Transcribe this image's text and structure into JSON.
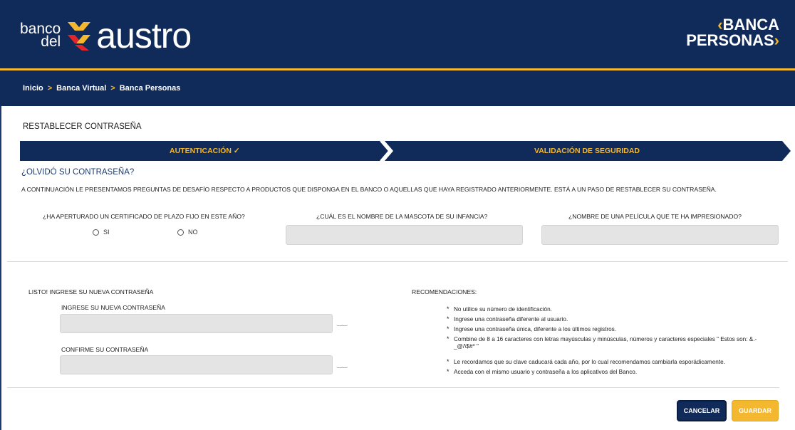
{
  "header": {
    "logo_banco": "banco",
    "logo_del": "del",
    "logo_austro": "austro",
    "brand_line1": "BANCA",
    "brand_line2": "PERSONAS",
    "colors": {
      "primary": "#102b5a",
      "accent": "#f3b82f"
    }
  },
  "breadcrumb": [
    "Inicio",
    "Banca Virtual",
    "Banca Personas"
  ],
  "page_title": "RESTABLECER CONTRASEÑA",
  "steps": {
    "step1": "AUTENTICACIÓN",
    "step1_icon": "check-icon",
    "step2": "VALIDACIÓN DE SEGURIDAD"
  },
  "forgot_title": "¿OLVIDÓ SU CONTRASEÑA?",
  "intro": "A CONTINUACIÓN LE PRESENTAMOS PREGUNTAS DE DESAFÍO RESPECTO A PRODUCTOS QUE DISPONGA EN EL BANCO O AQUELLAS QUE HAYA REGISTRADO ANTERIORMENTE. ESTÁ A UN PASO DE RESTABLECER SU CONTRASEÑA.",
  "questions": {
    "q1": "¿HA APERTURADO UN CERTIFICADO DE PLAZO FIJO EN ESTE AÑO?",
    "q1_yes": "SI",
    "q1_no": "NO",
    "q2": "¿CUÁL ES EL NOMBRE DE LA MASCOTA DE SU INFANCIA?",
    "q3": "¿NOMBRE DE UNA PELÍCULA QUE TE HA IMPRESIONADO?"
  },
  "new_password": {
    "section_title": "LISTO! INGRESE SU NUEVA CONTRASEÑA",
    "label_new": "INGRESE SU NUEVA CONTRASEÑA",
    "label_confirm": "CONFIRME SU CONTRASEÑA"
  },
  "recommendations": {
    "title": "RECOMENDACIONES:",
    "items": [
      "No utilice su número de identificación.",
      "Ingrese una contraseña diferente al usuario.",
      "Ingrese una contraseña única, diferente a los últimos registros.",
      "Combine de 8 a 16 caracteres con letras mayúsculas y minúsculas, números y caracteres especiales \" Estos son: &.-_@/\\$#* \"",
      "Le recordamos que su clave caducará cada año, por lo cual recomendamos cambiarla esporádicamente.",
      "Acceda con el mismo usuario y contraseña a los aplicativos del Banco."
    ]
  },
  "buttons": {
    "cancel": "CANCELAR",
    "save": "GUARDAR"
  }
}
